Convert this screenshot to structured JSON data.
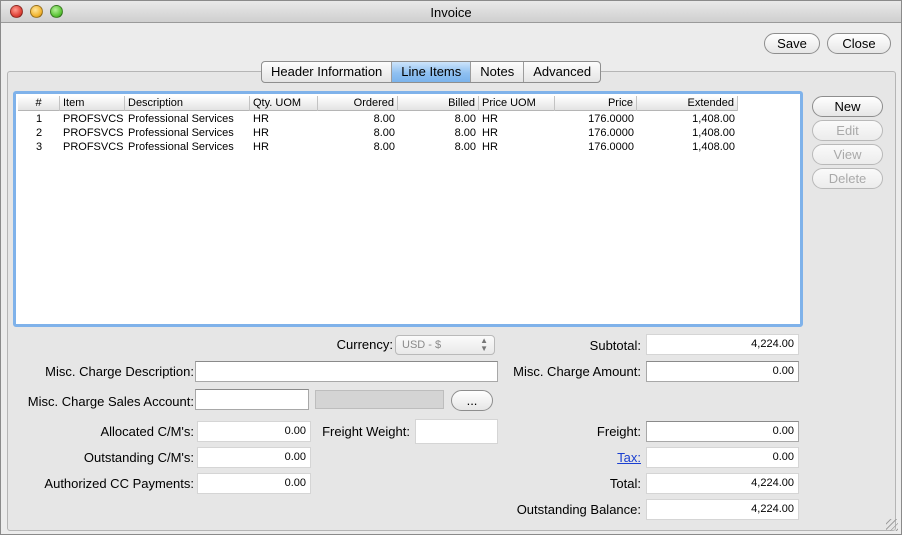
{
  "window": {
    "title": "Invoice"
  },
  "toolbar": {
    "save_label": "Save",
    "close_label": "Close"
  },
  "tabs": [
    {
      "label": "Header Information",
      "active": false
    },
    {
      "label": "Line Items",
      "active": true
    },
    {
      "label": "Notes",
      "active": false
    },
    {
      "label": "Advanced",
      "active": false
    }
  ],
  "table": {
    "columns": [
      "#",
      "Item",
      "Description",
      "Qty. UOM",
      "Ordered",
      "Billed",
      "Price UOM",
      "Price",
      "Extended"
    ],
    "rows": [
      [
        "1",
        "PROFSVCS",
        "Professional Services",
        "HR",
        "8.00",
        "8.00",
        "HR",
        "176.0000",
        "1,408.00"
      ],
      [
        "2",
        "PROFSVCS",
        "Professional Services",
        "HR",
        "8.00",
        "8.00",
        "HR",
        "176.0000",
        "1,408.00"
      ],
      [
        "3",
        "PROFSVCS",
        "Professional Services",
        "HR",
        "8.00",
        "8.00",
        "HR",
        "176.0000",
        "1,408.00"
      ]
    ]
  },
  "side_buttons": {
    "new": "New",
    "edit": "Edit",
    "view": "View",
    "delete": "Delete"
  },
  "form": {
    "currency_label": "Currency:",
    "currency_value": "USD - $",
    "misc_desc_label": "Misc. Charge Description:",
    "misc_desc_value": "",
    "misc_account_label": "Misc. Charge Sales Account:",
    "misc_account_value": "",
    "account_lookup_label": "...",
    "allocated_label": "Allocated C/M's:",
    "allocated_value": "0.00",
    "freight_weight_label": "Freight Weight:",
    "freight_weight_value": "",
    "outstanding_cm_label": "Outstanding C/M's:",
    "outstanding_cm_value": "0.00",
    "authorized_cc_label": "Authorized CC Payments:",
    "authorized_cc_value": "0.00",
    "subtotal_label": "Subtotal:",
    "subtotal_value": "4,224.00",
    "misc_amount_label": "Misc. Charge Amount:",
    "misc_amount_value": "0.00",
    "freight_label": "Freight:",
    "freight_value": "0.00",
    "tax_label": "Tax:",
    "tax_value": "0.00",
    "total_label": "Total:",
    "total_value": "4,224.00",
    "balance_label": "Outstanding Balance:",
    "balance_value": "4,224.00"
  }
}
